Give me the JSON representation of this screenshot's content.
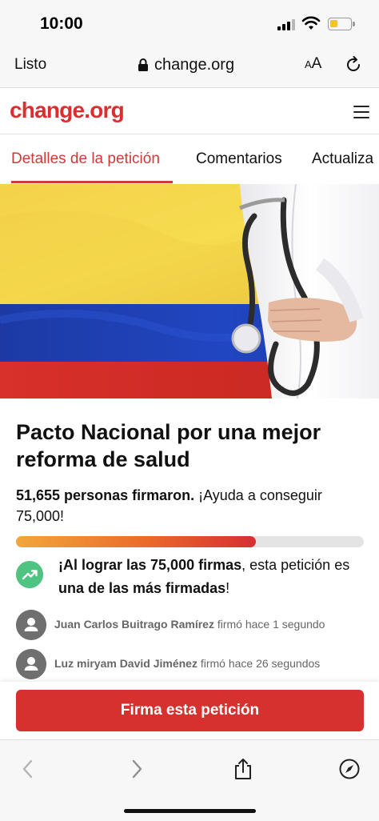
{
  "status_bar": {
    "time": "10:00"
  },
  "browser": {
    "done_label": "Listo",
    "url": "change.org",
    "text_size_label": {
      "small": "A",
      "large": "A"
    }
  },
  "site": {
    "logo": "change.org"
  },
  "tabs": [
    {
      "label": "Detalles de la petición",
      "active": true
    },
    {
      "label": "Comentarios",
      "active": false
    },
    {
      "label": "Actualiza",
      "active": false
    }
  ],
  "petition": {
    "title": "Pacto Nacional por una mejor reforma de salud",
    "signatures_bold": "51,655 personas firmaron.",
    "signatures_rest": " ¡Ayuda a conseguir 75,000!",
    "progress_fraction": 0.6887
  },
  "milestone": {
    "part1": "¡Al lograr las 75,000 firmas",
    "part2": ", esta petición es ",
    "part3": "una de las más firmadas",
    "part4": "!"
  },
  "recent_signers": [
    {
      "name": "Juan Carlos Buitrago Ramírez",
      "action": " firmó hace 1 segundo"
    },
    {
      "name": "Luz miryam David Jiménez",
      "action": " firmó hace 26 segundos"
    }
  ],
  "cta": {
    "sign_label": "Firma esta petición"
  },
  "icons": {
    "signal": "cellular-signal-icon",
    "wifi": "wifi-icon",
    "battery": "battery-icon",
    "lock": "lock-icon",
    "reload": "reload-icon",
    "menu": "hamburger-menu-icon",
    "trending": "trending-up-icon",
    "avatar": "user-avatar-icon",
    "back": "chevron-left-icon",
    "forward": "chevron-right-icon",
    "share": "share-icon",
    "compass": "compass-icon"
  },
  "colors": {
    "brand": "#d92f2f",
    "tab_active": "#cd3a37",
    "button": "#d6312f",
    "milestone": "#4fc481"
  }
}
